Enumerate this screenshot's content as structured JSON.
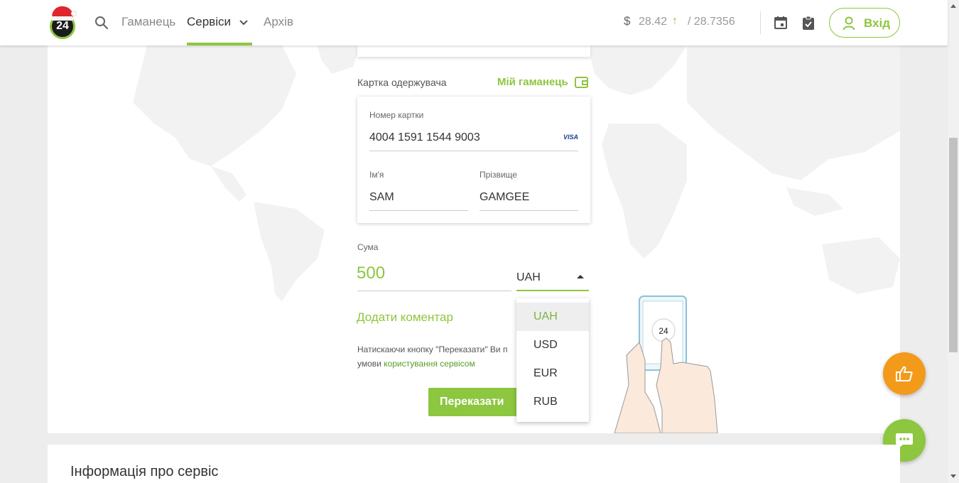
{
  "header": {
    "logo_text": "24",
    "nav": {
      "wallet": "Гаманець",
      "services": "Сервіси",
      "archive": "Архів"
    },
    "rate": {
      "currency_symbol": "$",
      "buy": "28.42",
      "arrow": "↑",
      "sell": "/ 28.7356"
    },
    "login_label": "Вхід"
  },
  "recipient": {
    "section_label": "Картка одержувача",
    "wallet_link": "Мій гаманець",
    "card_number_label": "Номер картки",
    "card_number": "4004 1591 1544 9003",
    "card_brand": "VISA",
    "first_name_label": "Ім'я",
    "first_name": "SAM",
    "last_name_label": "Прізвище",
    "last_name": "GAMGEE"
  },
  "amount": {
    "label": "Сума",
    "value": "500",
    "currency": "UAH",
    "options": [
      "UAH",
      "USD",
      "EUR",
      "RUB"
    ],
    "selected_option": "UAH"
  },
  "add_comment": "Додати коментар",
  "terms": {
    "prefix": "Натискаючи кнопку \"Переказати\" Ви п",
    "line2_prefix": "умови ",
    "link": "користування сервісом"
  },
  "submit_label": "Переказати",
  "illustration": {
    "phone_badge": "24"
  },
  "info_title": "Інформація про сервіс",
  "colors": {
    "accent": "#8dc63f",
    "like_button": "#f39a1b",
    "background": "#ededed"
  }
}
